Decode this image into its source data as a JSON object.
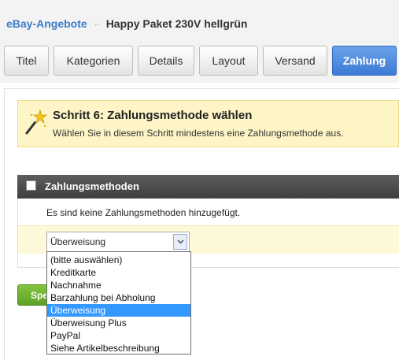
{
  "breadcrumb": {
    "link": "eBay-Angebote",
    "separator": "←",
    "title": "Happy Paket 230V hellgrün"
  },
  "tabs": [
    {
      "label": "Titel"
    },
    {
      "label": "Kategorien"
    },
    {
      "label": "Details"
    },
    {
      "label": "Layout"
    },
    {
      "label": "Versand"
    },
    {
      "label": "Zahlung",
      "active": true
    }
  ],
  "info": {
    "title": "Schritt 6: Zahlungsmethode wählen",
    "text": "Wählen Sie in diesem Schritt mindestens eine Zahlungsmethode aus.",
    "icon": "magic-wand-icon"
  },
  "section": {
    "title": "Zahlungsmethoden",
    "empty_text": "Es sind keine Zahlungsmethoden hinzugefügt.",
    "checkbox_checked": false
  },
  "select": {
    "value": "Überweisung",
    "options": [
      "(bitte auswählen)",
      "Kreditkarte",
      "Nachnahme",
      "Barzahlung bei Abholung",
      "Überweisung",
      "Überweisung Plus",
      "PayPal",
      "Siehe Artikelbeschreibung"
    ],
    "highlighted_option": "Überweisung"
  },
  "save_button": {
    "label": "Speichern",
    "visible_label": "Spe"
  },
  "colors": {
    "accent": "#3d7ad6",
    "info_bg": "#fdf5c5",
    "header_bg": "#4a4a4a",
    "save_green": "#6cb02f"
  }
}
